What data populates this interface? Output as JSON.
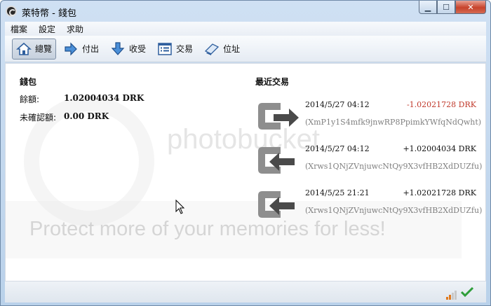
{
  "window": {
    "title": "萊特幣 - 錢包"
  },
  "menu": [
    "檔案",
    "設定",
    "求助"
  ],
  "toolbar": [
    {
      "label": "總覽",
      "icon": "home-icon",
      "active": true
    },
    {
      "label": "付出",
      "icon": "send-arrow-icon",
      "active": false
    },
    {
      "label": "收受",
      "icon": "receive-arrow-icon",
      "active": false
    },
    {
      "label": "交易",
      "icon": "transactions-list-icon",
      "active": false
    },
    {
      "label": "位址",
      "icon": "address-book-icon",
      "active": false
    }
  ],
  "wallet": {
    "heading": "錢包",
    "balance_label": "餘額:",
    "balance_value": "1.02004034 DRK",
    "unconfirmed_label": "未確認額:",
    "unconfirmed_value": "0.00 DRK"
  },
  "recent": {
    "heading": "最近交易",
    "items": [
      {
        "date": "2014/5/27 04:12",
        "amount": "-1.02021728 DRK",
        "address": "(XmP1y1S4mfk9jnwRP8PpimkYWfqNdQwht)",
        "direction": "out",
        "amount_color": "#c0392b"
      },
      {
        "date": "2014/5/27 04:12",
        "amount": "+1.02004034 DRK",
        "address": "(Xrws1QNjZVnjuwcNtQy9X3vfHB2XdDUZfu)",
        "direction": "in",
        "amount_color": "#111111"
      },
      {
        "date": "2014/5/25 21:21",
        "amount": "+1.02021728 DRK",
        "address": "(Xrws1QNjZVnjuwcNtQy9X3vfHB2XdDUZfu)",
        "direction": "in",
        "amount_color": "#111111"
      }
    ]
  },
  "watermark": {
    "line1": "photobucket",
    "line2": "Protect more of your memories for less!"
  },
  "status": {
    "icons": [
      "network-signal-icon",
      "synced-checkmark-icon"
    ]
  }
}
